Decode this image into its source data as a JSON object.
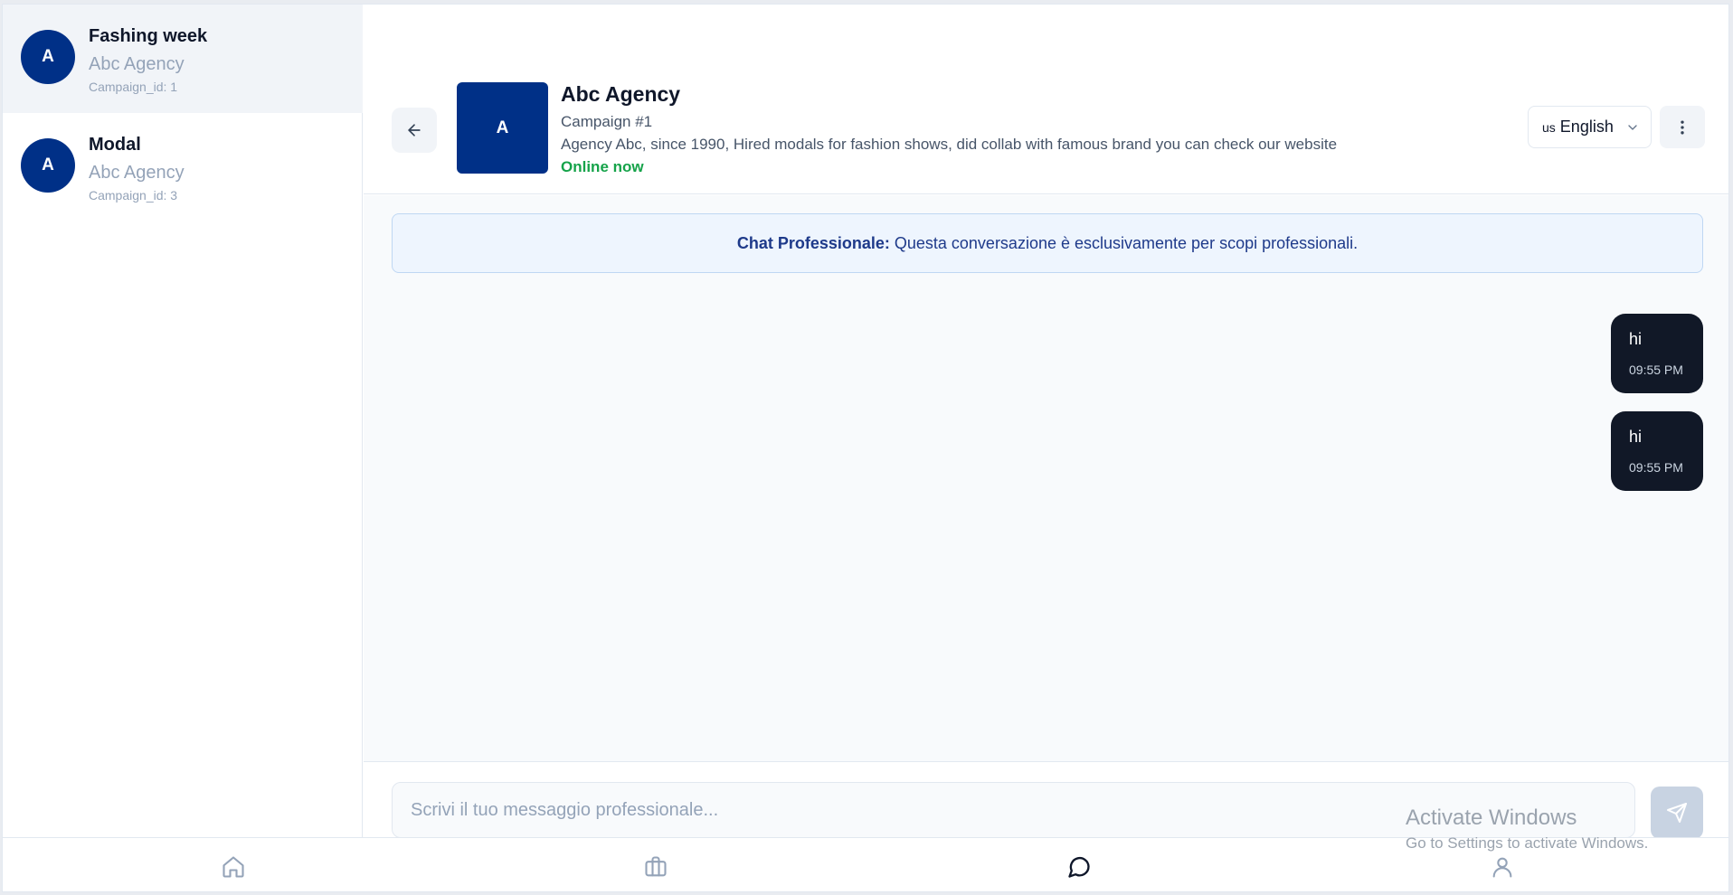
{
  "conversations": [
    {
      "avatar": "A",
      "title": "Fashing week",
      "agency": "Abc Agency",
      "campaign_id": "Campaign_id: 1"
    },
    {
      "avatar": "A",
      "title": "Modal",
      "agency": "Abc Agency",
      "campaign_id": "Campaign_id: 3"
    }
  ],
  "header": {
    "avatar": "A",
    "title": "Abc Agency",
    "campaign": "Campaign #1",
    "description": "Agency Abc, since 1990, Hired modals for fashion shows, did collab with famous brand you can check our website",
    "status": "Online now",
    "language_flag": "us",
    "language": "English"
  },
  "notice": {
    "bold": "Chat Professionale:",
    "text": "Questa conversazione è esclusivamente per scopi professionali."
  },
  "messages": [
    {
      "text": "hi",
      "time": "09:55 PM"
    },
    {
      "text": "hi",
      "time": "09:55 PM"
    }
  ],
  "composer": {
    "placeholder": "Scrivi il tuo messaggio professionale..."
  },
  "watermark": {
    "line1": "Activate Windows",
    "line2": "Go to Settings to activate Windows."
  },
  "colors": {
    "brand": "#003087",
    "online": "#16a34a",
    "bubble": "#111827"
  },
  "icons": {
    "back": "arrow-left-icon",
    "more": "more-vertical-icon",
    "send": "send-icon",
    "nav": [
      "home-icon",
      "briefcase-icon",
      "chat-icon",
      "user-icon"
    ]
  }
}
